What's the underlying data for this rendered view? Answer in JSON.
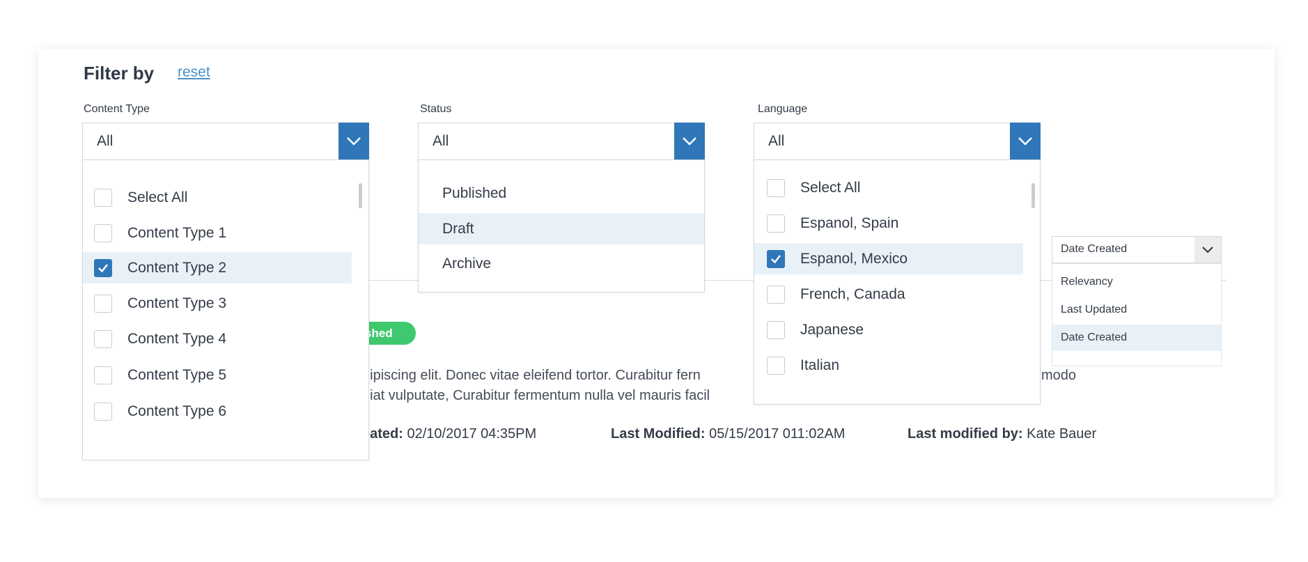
{
  "filter": {
    "title": "Filter by",
    "reset_label": "reset"
  },
  "content_type": {
    "label": "Content Type",
    "value": "All",
    "options": [
      {
        "label": "Select All",
        "checked": false
      },
      {
        "label": "Content Type 1",
        "checked": false
      },
      {
        "label": "Content Type 2",
        "checked": true
      },
      {
        "label": "Content Type 3",
        "checked": false
      },
      {
        "label": "Content Type 4",
        "checked": false
      },
      {
        "label": "Content Type 5",
        "checked": false
      },
      {
        "label": "Content Type 6",
        "checked": false
      }
    ]
  },
  "status": {
    "label": "Status",
    "value": "All",
    "options": [
      {
        "label": "Published",
        "selected": false
      },
      {
        "label": "Draft",
        "selected": true
      },
      {
        "label": "Archive",
        "selected": false
      }
    ]
  },
  "language": {
    "label": "Language",
    "value": "All",
    "options": [
      {
        "label": "Select All",
        "checked": false
      },
      {
        "label": "Espanol, Spain",
        "checked": false
      },
      {
        "label": "Espanol, Mexico",
        "checked": true
      },
      {
        "label": "French, Canada",
        "checked": false
      },
      {
        "label": "Japanese",
        "checked": false
      },
      {
        "label": "Italian",
        "checked": false
      }
    ]
  },
  "sort": {
    "value": "Date Created",
    "options": [
      {
        "label": "Relevancy",
        "selected": false
      },
      {
        "label": "Last Updated",
        "selected": false
      },
      {
        "label": "Date Created",
        "selected": true
      }
    ]
  },
  "result": {
    "badge": "shed",
    "desc_line1": "dipiscing elit. Donec vitae eleifend tortor. Curabitur fern",
    "desc_line1_tail": "modo",
    "desc_line2": "giat vulputate, Curabitur fermentum nulla vel mauris facil",
    "created_label": "eated:",
    "created_value": "02/10/2017 04:35PM",
    "modified_label": "Last Modified:",
    "modified_value": "05/15/2017 011:02AM",
    "modified_by_label": "Last modified by:",
    "modified_by_value": "Kate Bauer"
  },
  "colors": {
    "accent": "#2f77b8",
    "badge": "#3ec96f",
    "selected_row": "#e9f1f8",
    "link": "#4a90c7"
  }
}
